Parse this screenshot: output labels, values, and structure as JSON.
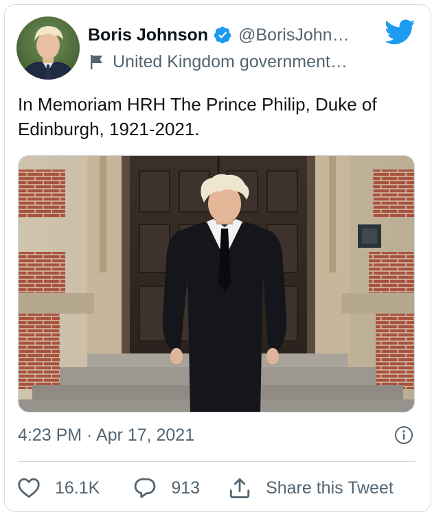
{
  "author": {
    "display_name": "Boris Johnson",
    "handle": "@BorisJohn…",
    "label": "United Kingdom government…",
    "verified_color": "#1d9bf0"
  },
  "brand": {
    "icon": "twitter-bird-icon",
    "color": "#1d9bf0"
  },
  "tweet": {
    "text": "In Memoriam HRH The Prince Philip, Duke of Edinburgh, 1921-2021.",
    "timestamp": "4:23 PM · Apr 17, 2021"
  },
  "actions": {
    "likes": "16.1K",
    "replies": "913",
    "share_label": "Share this Tweet"
  },
  "colors": {
    "text_primary": "#0f1419",
    "text_secondary": "#536471",
    "border": "#cfd9de"
  }
}
